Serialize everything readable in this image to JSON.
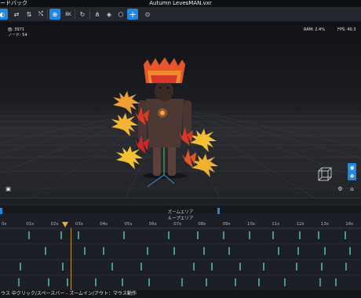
{
  "titlebar": {
    "left_text": "ードバック",
    "title": "Autumn LevesMAN.vxr"
  },
  "toolbar": {
    "buttons": [
      {
        "name": "app-menu-button",
        "glyph": "◐",
        "active": true
      },
      {
        "name": "swap-button",
        "glyph": "⇄",
        "active": false
      },
      {
        "name": "sort-button",
        "glyph": "⇅",
        "active": false
      },
      {
        "name": "shuffle-button",
        "glyph": "⤭",
        "active": false
      },
      {
        "name": "zoom-tool-button",
        "glyph": "⊕",
        "active": true
      },
      {
        "name": "resolution-button",
        "glyph": "8K",
        "active": false
      },
      {
        "name": "refresh-button",
        "glyph": "↻",
        "active": false
      },
      {
        "name": "hierarchy-button",
        "glyph": "⋔",
        "active": false
      },
      {
        "name": "object-button",
        "glyph": "◈",
        "active": false
      },
      {
        "name": "cube-button",
        "glyph": "⬡",
        "active": false
      },
      {
        "name": "add-button",
        "glyph": "+",
        "active": true
      },
      {
        "name": "target-button",
        "glyph": "⊙",
        "active": false
      }
    ]
  },
  "viewport": {
    "stats_line1": "面: 3971",
    "stats_line2": "ノード: 54",
    "ram": "RAM: 2.4%",
    "fps": "FPS: 40.3"
  },
  "timeline": {
    "zoom_area_label": "ズームエリア",
    "loop_area_label": "ループエリア",
    "ticks": [
      "0s",
      "01s",
      "02s",
      "03s",
      "04s",
      "05s",
      "06s",
      "07s",
      "08s",
      "09s",
      "10s",
      "11s",
      "12s",
      "13s",
      "14s"
    ],
    "playhead_time_s": 2.7
  },
  "status": {
    "text": "ウス 中クリック/スペースバー - ズームイン/アウト：マウス動作"
  },
  "colors": {
    "accent": "#1e88e5",
    "keyframe": "#6ee7c8",
    "playhead": "#e6b422"
  }
}
